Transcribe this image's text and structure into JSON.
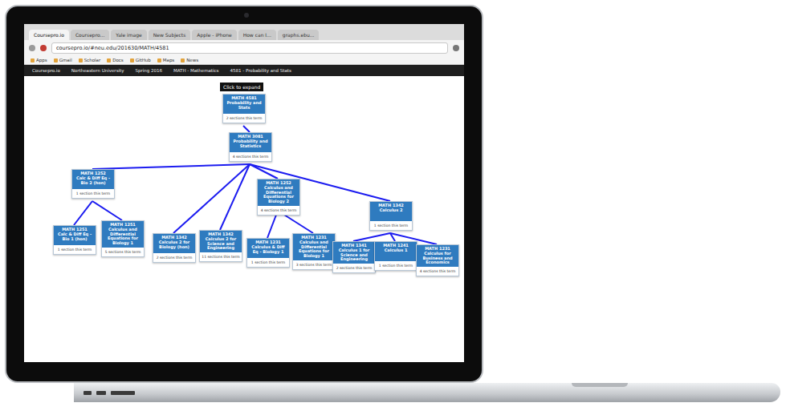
{
  "browser": {
    "tabs": [
      {
        "label": "Coursepro.io",
        "selected": true
      },
      {
        "label": "Coursepro...",
        "selected": false
      },
      {
        "label": "Yale image",
        "selected": false
      },
      {
        "label": "New Subjects",
        "selected": false
      },
      {
        "label": "Apple - iPhone",
        "selected": false
      },
      {
        "label": "How can I...",
        "selected": false
      },
      {
        "label": "graphs.ebu...",
        "selected": false
      }
    ],
    "address": "coursepro.io/#neu.edu/201630/MATH/4581",
    "bookmarks": [
      "Apps",
      "Gmail",
      "Scholar",
      "Docs",
      "GitHub",
      "Maps",
      "News"
    ]
  },
  "header": {
    "crumbs": [
      "Coursepro.io",
      "Northeastern University",
      "Spring 2016",
      "MATH - Mathematics",
      "4581 - Probability and Stats"
    ]
  },
  "diagram": {
    "banner": "Click to expand",
    "tree": {
      "code": "MATH 4581",
      "title": "Probability and Stats",
      "sections": "2 sections this term",
      "children": [
        {
          "code": "MATH 3081",
          "title": "Probability and Statistics",
          "sections": "4 sections this term",
          "children": [
            {
              "code": "MATH 1252",
              "title": "Calc & Diff Eq - Bio 2 (hon)",
              "sections": "1 section this term",
              "children": [
                {
                  "code": "MATH 1251",
                  "title": "Calc & Diff Eq - Bio 1 (hon)",
                  "sections": "1 section this term",
                  "children": []
                },
                {
                  "code": "MATH 1251",
                  "title": "Calculus and Differential Equations for Biology 1",
                  "sections": "5 sections this term",
                  "children": []
                }
              ]
            },
            {
              "code": "MATH 1342",
              "title": "Calculus 2 for Biology (hon)",
              "sections": "2 sections this term",
              "children": []
            },
            {
              "code": "MATH 1342",
              "title": "Calculus 2 for Science and Engineering",
              "sections": "11 sections this term",
              "children": []
            },
            {
              "code": "MATH 1252",
              "title": "Calculus and Differential Equations for Biology 2",
              "sections": "4 sections this term",
              "children": [
                {
                  "code": "MATH 1231",
                  "title": "Calculus & Diff Eq - Biology 1",
                  "sections": "1 section this term",
                  "children": []
                },
                {
                  "code": "MATH 1231",
                  "title": "Calculus and Differential Equations for Biology 1",
                  "sections": "3 sections this term",
                  "children": []
                }
              ]
            },
            {
              "code": "MATH 1342",
              "title": "Calculus 2",
              "sections": "1 section this term",
              "children": [
                {
                  "code": "MATH 1341",
                  "title": "Calculus 1 for Science and Engineering",
                  "sections": "2 sections this term",
                  "children": []
                },
                {
                  "code": "MATH 1241",
                  "title": "Calculus 1",
                  "sections": "1 section this term",
                  "children": []
                },
                {
                  "code": "MATH 1231",
                  "title": "Calculus for Business and Economics",
                  "sections": "4 sections this term",
                  "children": []
                }
              ]
            }
          ]
        }
      ]
    }
  }
}
